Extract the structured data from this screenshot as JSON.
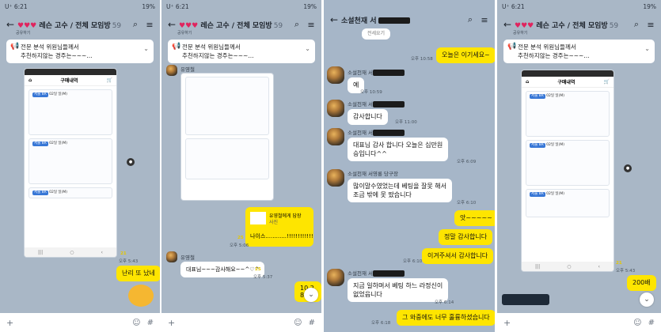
{
  "screens": [
    {
      "status_time": "U⁺ 6:21",
      "status_right": "19%",
      "title": "레슨 고수 / 전체 모임방",
      "member_count": "59",
      "subtitle": "공유하기",
      "notice_line1": "전문 분석 위원님들께서",
      "notice_line2": "추천하지않는 경주는~~~...",
      "shared_app_title": "구매내역",
      "ticket_tag": "서울 8R",
      "ticket_date": "02일 일(M)",
      "chat_time": "오후 5:43",
      "read_count": "21",
      "my_message": "난리 또 났네"
    },
    {
      "status_time": "U⁺ 6:21",
      "status_right": "19%",
      "title": "레슨 고수 / 전체 모임방",
      "member_count": "59",
      "subtitle": "공유하기",
      "notice_line1": "전문 분석 위원님들께서",
      "notice_line2": "추천하지않는 경주는~~~...",
      "sender1": "유영철",
      "shared_app_title": "구매내역",
      "photo_title": "유영철에게 답장",
      "photo_sub": "사진",
      "reply_read": "25",
      "reply_time": "오후 5:06",
      "reply_text": "나이스............!!!!!!!!!!!!",
      "sender2": "유영철",
      "other_message": "대표님~~~감사해요~~^♡^",
      "other_read": "25",
      "other_time": "오후 5:37",
      "partial_message": "10.2\n8"
    },
    {
      "title": "소설천재 서",
      "top_cut_text": "전세요기",
      "m1_text": "오늘은 이기세요~",
      "m1_time": "오후 10:58",
      "sender": "소설천재 서",
      "m2_text": "예",
      "m2_time": "오후 10:59",
      "m3_text": "감사합니다",
      "m3_time": "오후 11:00",
      "m4_line1": "대표님 감사 합니다  오늘은  십만원",
      "m4_line2": "승입니다^^",
      "m4_time": "오후 6:09",
      "sender_full": "소설천재 서영룡 당구장",
      "m5_line1": "많이말수였었는데 베팅을 잘못 해서",
      "m5_line2": "조금 밖에  못  땄습니다",
      "m5_time": "오후 6:10",
      "m6_text": "앗~~~~~",
      "m7_text": "정말 감사합니다",
      "m8_text": "이겨주셔서 감사합니다",
      "m8_time": "오후 6:10",
      "m9_line1": "지금 일하며서 베팅 하느 라정신이",
      "m9_line2": "없었읍니다",
      "m9_time": "오후 6:14",
      "m10_text": "그 와중에도 너무 훌륭하셨습니다",
      "m10_time": "오후 6:18"
    },
    {
      "status_time": "U⁺ 6:21",
      "status_right": "19%",
      "title": "레슨 고수 / 전체 모임방",
      "member_count": "59",
      "subtitle": "공유하기",
      "notice_line1": "전문 분석 위원님들께서",
      "notice_line2": "추천하지않는 경주는~~~...",
      "shared_app_title": "구매내역",
      "ticket_tag": "서울 8R",
      "ticket_date": "02일 일(M)",
      "read_count": "21",
      "chat_time": "오후 5:43",
      "my_message": "200배"
    }
  ]
}
